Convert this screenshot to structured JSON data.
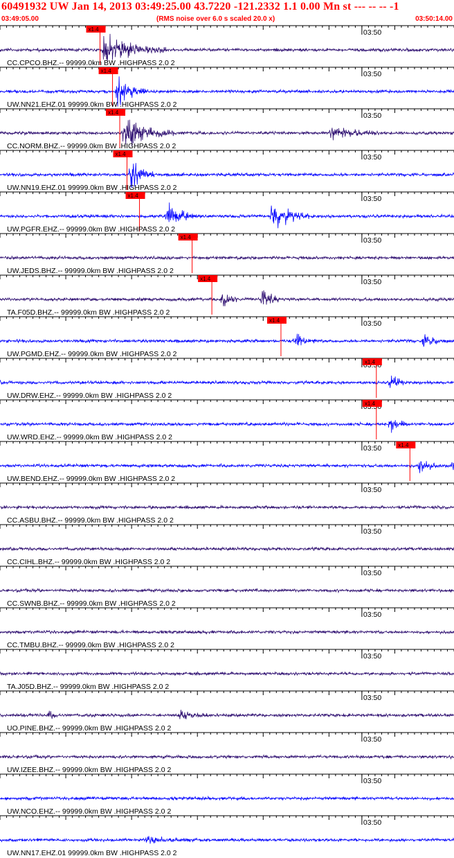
{
  "header": {
    "title": "60491932 UW Jan 14, 2013 03:49:25.00   43.7220 -121.2332  1.1 0.00 Mn st --- -- --  -1",
    "start_time": "03:49:05.00",
    "note": "(RMS noise over 6.0 s scaled 20.0 x)",
    "end_time": "03:50:14.00"
  },
  "colors": {
    "header_text": "#ff0000",
    "pick": "#ff0000",
    "trace_blue": "#0000ff",
    "trace_dark": "#2a0a6e",
    "axis": "#000000",
    "background": "#ffffff"
  },
  "chart_data": {
    "type": "line",
    "title": "60491932 UW Jan 14, 2013 03:49:25.00   43.7220 -121.2332  1.1 0.00 Mn st --- -- --  -1",
    "time_range": [
      "03:49:05.00",
      "03:50:14.00"
    ],
    "time_range_s": [
      0,
      69
    ],
    "minute_tick_label": "03:50",
    "minute_tick_s": 55,
    "pick_label": "x1.4",
    "grid": false,
    "series": [
      {
        "name": "CC.CPCO.BHZ.-- 99999.0km BW .HIGHPASS  2.0  2",
        "color": "dark",
        "pick_s": 15.2,
        "bursts": [
          {
            "t": 15.5,
            "dur": 10,
            "amp": 30
          }
        ]
      },
      {
        "name": "UW.NN21.EHZ.01 99999.0km BW .HIGHPASS  2.0  2",
        "color": "blue",
        "pick_s": 17.1,
        "bursts": [
          {
            "t": 17.5,
            "dur": 5,
            "amp": 24
          }
        ]
      },
      {
        "name": "CC.NORM.BHZ.-- 99999.0km BW .HIGHPASS  2.0  2",
        "color": "dark",
        "pick_s": 18.2,
        "bursts": [
          {
            "t": 18.5,
            "dur": 8,
            "amp": 28
          },
          {
            "t": 50,
            "dur": 8,
            "amp": 12
          }
        ]
      },
      {
        "name": "UW.NN19.EHZ.01 99999.0km BW .HIGHPASS  2.0  2",
        "color": "blue",
        "pick_s": 19.3,
        "bursts": [
          {
            "t": 19.5,
            "dur": 4,
            "amp": 26
          }
        ]
      },
      {
        "name": "UW.PGFR.EHZ.-- 99999.0km BW .HIGHPASS  2.0  2",
        "color": "blue",
        "pick_s": 21.2,
        "bursts": [
          {
            "t": 25,
            "dur": 5,
            "amp": 24
          },
          {
            "t": 41,
            "dur": 6,
            "amp": 28
          }
        ]
      },
      {
        "name": "UW.JEDS.BHZ.-- 99999.0km BW .HIGHPASS  2.0  2",
        "color": "dark",
        "pick_s": 29.2,
        "bursts": []
      },
      {
        "name": "TA.F05D.BHZ.-- 99999.0km BW .HIGHPASS  2.0  2",
        "color": "dark",
        "pick_s": 32.2,
        "bursts": [
          {
            "t": 33.5,
            "dur": 3,
            "amp": 16
          },
          {
            "t": 39.5,
            "dur": 3,
            "amp": 20
          }
        ]
      },
      {
        "name": "UW.PGMD.EHZ.-- 99999.0km BW .HIGHPASS  2.0  2",
        "color": "blue",
        "pick_s": 42.7,
        "bursts": [
          {
            "t": 44.5,
            "dur": 4,
            "amp": 12
          },
          {
            "t": 64,
            "dur": 4,
            "amp": 9
          }
        ]
      },
      {
        "name": "UW.DRW.EHZ.-- 99999.0km BW .HIGHPASS  2.0  2",
        "color": "blue",
        "pick_s": 57.2,
        "bursts": [
          {
            "t": 59,
            "dur": 3,
            "amp": 12
          }
        ]
      },
      {
        "name": "UW.WRD.EHZ.-- 99999.0km BW .HIGHPASS  2.0  2",
        "color": "blue",
        "pick_s": 57.2,
        "bursts": [
          {
            "t": 59,
            "dur": 3,
            "amp": 14
          }
        ]
      },
      {
        "name": "UW.BEND.EHZ.-- 99999.0km BW .HIGHPASS  2.0  2",
        "color": "blue",
        "pick_s": 62.3,
        "bursts": [
          {
            "t": 63.5,
            "dur": 3,
            "amp": 16
          },
          {
            "t": 68.5,
            "dur": 1.5,
            "amp": 12
          }
        ]
      },
      {
        "name": "CC.ASBU.BHZ.-- 99999.0km BW .HIGHPASS  2.0  2",
        "color": "dark",
        "pick_s": null,
        "bursts": []
      },
      {
        "name": "CC.CIHL.BHZ.-- 99999.0km BW .HIGHPASS  2.0  2",
        "color": "dark",
        "pick_s": null,
        "bursts": []
      },
      {
        "name": "CC.SWNB.BHZ.-- 99999.0km BW .HIGHPASS  2.0  2",
        "color": "dark",
        "pick_s": null,
        "bursts": []
      },
      {
        "name": "CC.TMBU.BHZ.-- 99999.0km BW .HIGHPASS  2.0  2",
        "color": "dark",
        "pick_s": null,
        "bursts": []
      },
      {
        "name": "TA.J05D.BHZ.-- 99999.0km BW .HIGHPASS  2.0  2",
        "color": "dark",
        "pick_s": null,
        "bursts": []
      },
      {
        "name": "UO.PINE.BHZ.-- 99999.0km BW .HIGHPASS  2.0  2",
        "color": "dark",
        "pick_s": null,
        "bursts": [
          {
            "t": 7,
            "dur": 2,
            "amp": 6
          },
          {
            "t": 27,
            "dur": 5,
            "amp": 7
          }
        ]
      },
      {
        "name": "UW.IZEE.BHZ.-- 99999.0km BW .HIGHPASS  2.0  2",
        "color": "dark",
        "pick_s": null,
        "bursts": []
      },
      {
        "name": "UW.NCO.EHZ.-- 99999.0km BW .HIGHPASS  2.0  2",
        "color": "blue",
        "pick_s": null,
        "bursts": []
      },
      {
        "name": "UW.NN17.EHZ.01 99999.0km BW .HIGHPASS  2.0  2",
        "color": "blue",
        "pick_s": null,
        "bursts": [
          {
            "t": 22,
            "dur": 8,
            "amp": 5
          }
        ]
      }
    ]
  }
}
